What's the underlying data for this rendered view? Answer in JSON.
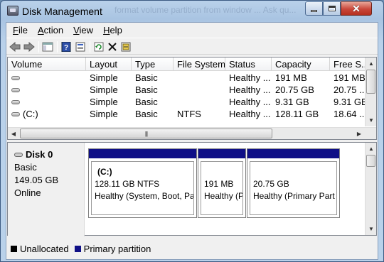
{
  "window": {
    "title": "Disk Management",
    "ghost_title_text": "format volume partition from window ... Ask qu...",
    "colors": {
      "primary_partition": "#0f0f86",
      "unallocated": "#000000"
    }
  },
  "menu": [
    "File",
    "Action",
    "View",
    "Help"
  ],
  "menu_mnemonics": [
    "F",
    "A",
    "V",
    "H"
  ],
  "toolbar_icons": [
    "back-arrow-icon",
    "forward-arrow-icon",
    "console-tree-icon",
    "help-icon",
    "properties-icon",
    "refresh-icon",
    "delete-icon",
    "rescan-disks-icon"
  ],
  "volume_list": {
    "columns": [
      "Volume",
      "Layout",
      "Type",
      "File System",
      "Status",
      "Capacity",
      "Free S..."
    ],
    "rows": [
      {
        "volume": "",
        "layout": "Simple",
        "type": "Basic",
        "fs": "",
        "status": "Healthy ...",
        "capacity": "191 MB",
        "free": "191 MB"
      },
      {
        "volume": "",
        "layout": "Simple",
        "type": "Basic",
        "fs": "",
        "status": "Healthy ...",
        "capacity": "20.75 GB",
        "free": "20.75 ..."
      },
      {
        "volume": "",
        "layout": "Simple",
        "type": "Basic",
        "fs": "",
        "status": "Healthy ...",
        "capacity": "9.31 GB",
        "free": "9.31 GB"
      },
      {
        "volume": "(C:)",
        "layout": "Simple",
        "type": "Basic",
        "fs": "NTFS",
        "status": "Healthy ...",
        "capacity": "128.11 GB",
        "free": "18.64 ..."
      }
    ]
  },
  "disk": {
    "name": "Disk 0",
    "type": "Basic",
    "size": "149.05 GB",
    "status": "Online",
    "partitions": [
      {
        "title": "(C:)",
        "size_fs": "128.11 GB NTFS",
        "status": "Healthy (System, Boot, Pa"
      },
      {
        "title": "",
        "size_fs": "191 MB",
        "status": "Healthy (P"
      },
      {
        "title": "",
        "size_fs": "20.75 GB",
        "status": "Healthy (Primary Part"
      }
    ]
  },
  "legend": {
    "unallocated": "Unallocated",
    "primary": "Primary partition"
  }
}
